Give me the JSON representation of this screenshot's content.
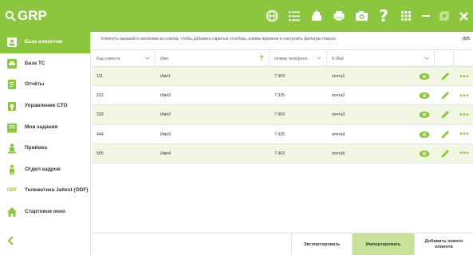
{
  "app": {
    "title": "GRP"
  },
  "colors": {
    "accent": "#8cc63f",
    "row_alt": "#f1f7e2",
    "button_active": "#c9e29b"
  },
  "toolbar": {
    "icons": [
      "globe-icon",
      "list-icon",
      "printer-user-icon",
      "printer-icon",
      "camera-icon",
      "help-icon",
      "grid-icon"
    ],
    "window": [
      "minimize-icon",
      "restore-icon",
      "close-icon"
    ]
  },
  "sidebar": {
    "items": [
      {
        "label": "База клиентов",
        "icon": "clients-icon",
        "active": true
      },
      {
        "label": "База ТС",
        "icon": "car-icon",
        "active": false
      },
      {
        "label": "Отчёты",
        "icon": "reports-icon",
        "active": false
      },
      {
        "label": "Управление СТО",
        "icon": "service-station-icon",
        "active": false
      },
      {
        "label": "Мои задания",
        "icon": "tasks-icon",
        "active": false
      },
      {
        "label": "Приёмка",
        "icon": "reception-icon",
        "active": false
      },
      {
        "label": "Отдел кадров",
        "icon": "hr-icon",
        "active": false
      },
      {
        "label": "Телематика Jaltest (ODF)",
        "icon": "odf-icon",
        "active": false
      },
      {
        "label": "Стартовое окно",
        "icon": "home-icon",
        "active": false
      }
    ],
    "back_icon": "back-arrow-icon"
  },
  "main": {
    "hint": "Кликнуть мышкой в заголовки из списка, чтобы добавить скрытые столбцы, нормы времени и настроить фильтры поиска",
    "count": "(5/5",
    "columns": [
      "Код клиента",
      "Имя",
      "Номер телефона",
      "E-Mail"
    ],
    "rows": [
      {
        "code": "111",
        "name": "Имя1",
        "phone": "7 963",
        "email": "почта1"
      },
      {
        "code": "222",
        "name": "Имя2",
        "phone": "7 925",
        "email": "почта2"
      },
      {
        "code": "333",
        "name": "Имя2",
        "phone": "7 963",
        "email": "почта3"
      },
      {
        "code": "444",
        "name": "Имя3",
        "phone": "7 925",
        "email": "почта4"
      },
      {
        "code": "555",
        "name": "Имя4",
        "phone": "7 963",
        "email": "почта5"
      }
    ]
  },
  "bottom": {
    "export_label": "Экспортировать",
    "import_label": "Импортировать",
    "add_label": "Добавить нового клиента"
  }
}
